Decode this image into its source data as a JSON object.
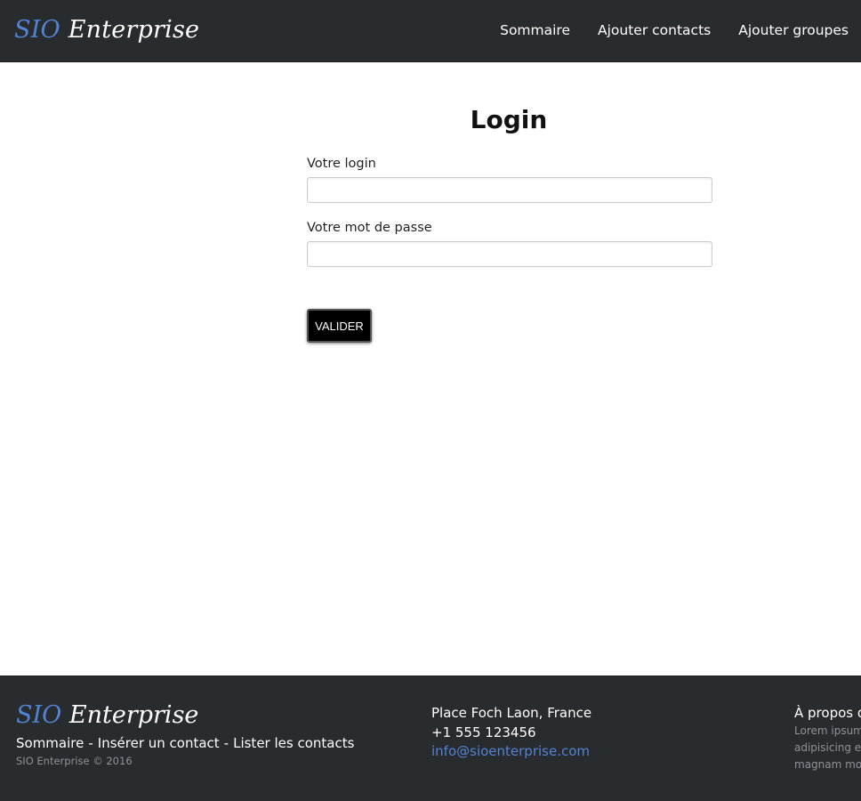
{
  "header": {
    "brand_accent": "SIO",
    "brand_name": "Enterprise",
    "nav": [
      "Sommaire",
      "Ajouter contacts",
      "Ajouter groupes"
    ]
  },
  "form": {
    "title": "Login",
    "login_label": "Votre login",
    "login_value": "",
    "password_label": "Votre mot de passe",
    "password_value": "",
    "submit_label": "Valider"
  },
  "footer": {
    "brand_accent": "SIO",
    "brand_name": "Enterprise",
    "links": [
      "Sommaire",
      "Insérer un contact",
      "Lister les contacts"
    ],
    "separator": "-",
    "copyright": "SIO Enterprise © 2016",
    "address": "Place Foch Laon, France",
    "phone": "+1 555 123456",
    "email": "info@sioenterprise.com",
    "about_title": "À propos de",
    "about_lines": [
      "Lorem ipsum dolor sit amet,",
      "adipisicing elit.",
      "magnam molestiae"
    ]
  },
  "colors": {
    "header_bg": "#292c2f",
    "accent": "#5383d3",
    "button_bg": "#000000"
  }
}
